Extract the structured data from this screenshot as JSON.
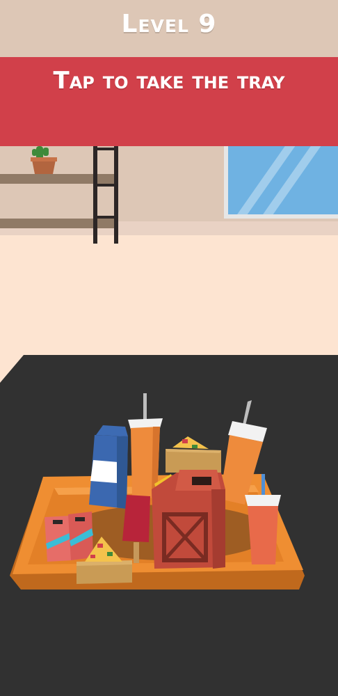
{
  "hud": {
    "level_label": "Level 9",
    "instruction": "Tap to take the tray"
  },
  "scene": {
    "items": [
      "cactus-pot",
      "shelf",
      "metal-rack",
      "window",
      "table",
      "tray",
      "milk-carton",
      "juice-cup",
      "pizza-slice",
      "soda-cup",
      "fuel-canister",
      "ice-pop",
      "soda-cans",
      "pizza-slice-small",
      "cheese-wedge"
    ],
    "colors": {
      "banner": "#d1404a",
      "wall": "#ddc7b6",
      "floor": "#fde4d1",
      "table": "#313131",
      "tray": "#ef8e32",
      "window": "#6fb2e2"
    }
  }
}
